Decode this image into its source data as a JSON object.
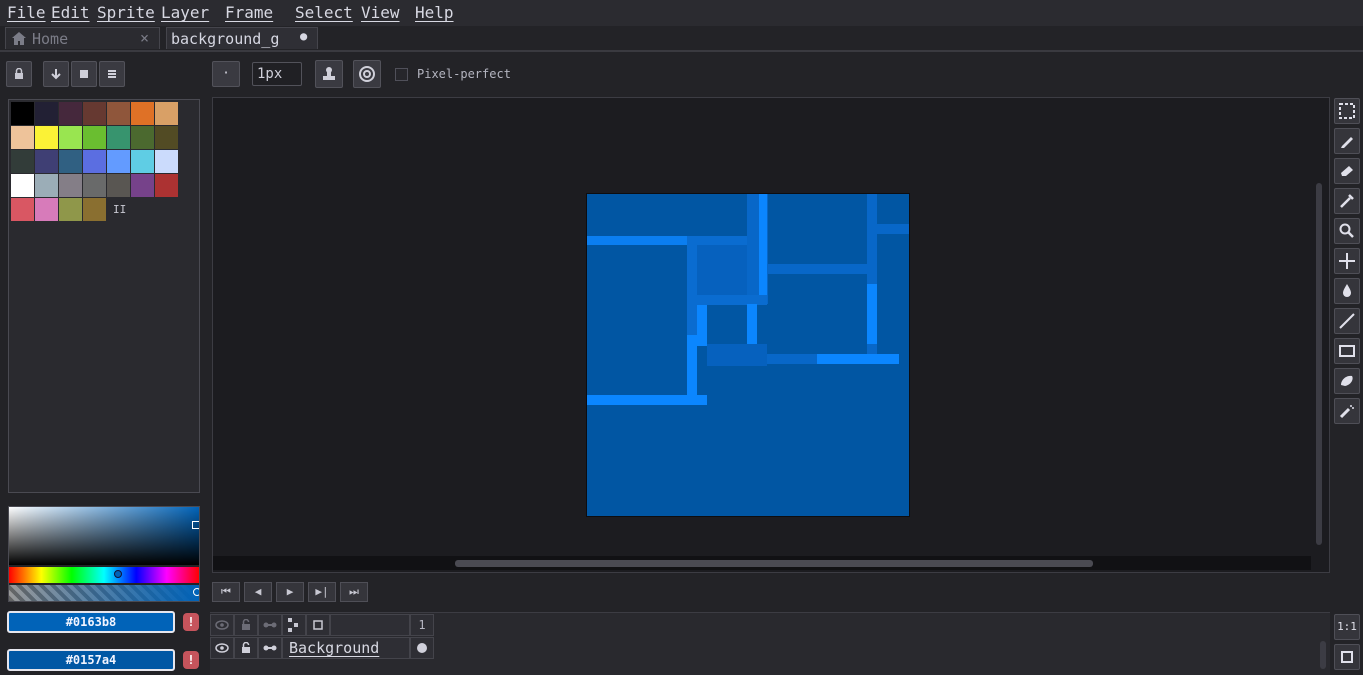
{
  "menu": [
    "File",
    "Edit",
    "Sprite",
    "Layer",
    "Frame",
    "Select",
    "View",
    "Help"
  ],
  "tabs": {
    "home": "Home",
    "home_close": "×",
    "document": "background_g",
    "document_dot": "●"
  },
  "toolbar": {
    "brush_size": "1px",
    "brush_dot": "·",
    "pixel_perfect": "Pixel-perfect"
  },
  "palette": {
    "colors": [
      "#000000",
      "#222034",
      "#45283c",
      "#663931",
      "#8f563b",
      "#df7126",
      "#d9a066",
      "#eec39a",
      "#fbf236",
      "#99e550",
      "#6abe30",
      "#37946e",
      "#4b692f",
      "#524b24",
      "#323c39",
      "#3f3f74",
      "#306082",
      "#5b6ee1",
      "#639bff",
      "#5fcde4",
      "#cbdbfc",
      "#ffffff",
      "#9badb7",
      "#847e87",
      "#696a6a",
      "#595652",
      "#76428a",
      "#ac3232",
      "#d95763",
      "#d77bba",
      "#8f974a",
      "#8a6f30"
    ],
    "extra_glyph": "II"
  },
  "colors": {
    "foreground": "#0163b8",
    "background": "#0157a4",
    "warn_glyph": "!"
  },
  "playback": [
    "⏮",
    "◀",
    "▶",
    "▶|",
    "⏭"
  ],
  "timeline": {
    "frame_number": "1",
    "layer_name": "Background"
  },
  "zoom_label": "1:1"
}
